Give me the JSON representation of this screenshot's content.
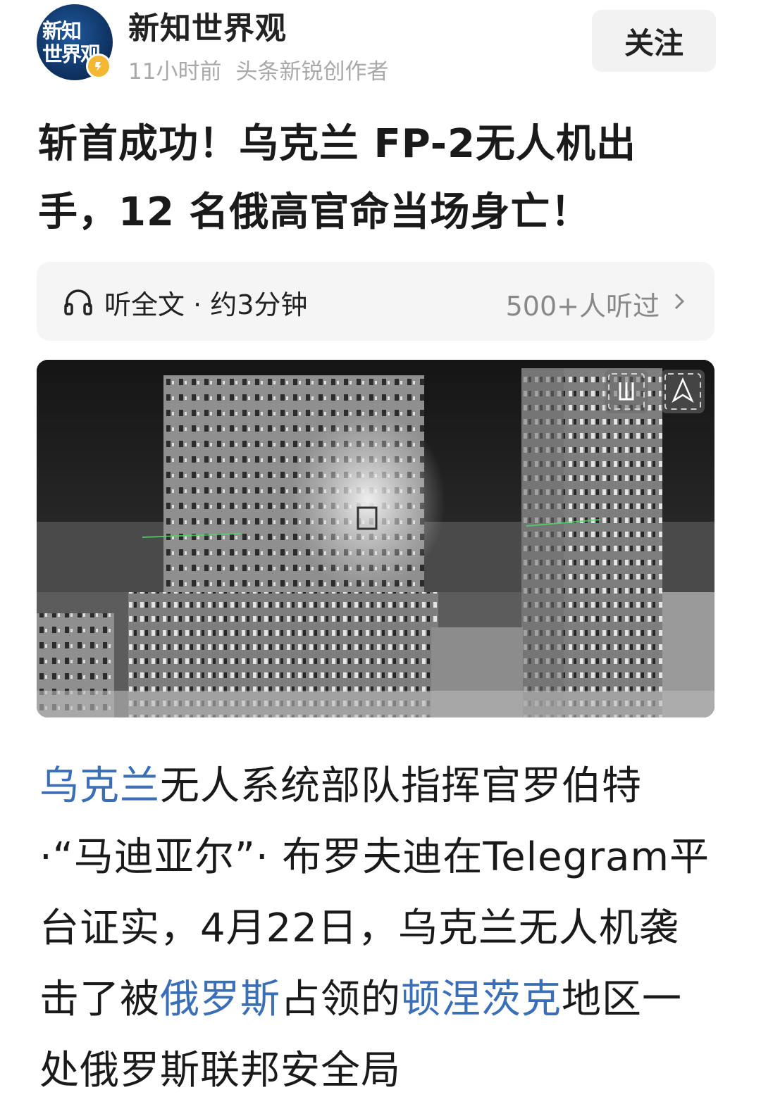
{
  "author": {
    "avatar_text": "新知\n世界观",
    "name": "新知世界观",
    "time": "11小时前",
    "badge": "头条新锐创作者",
    "follow_label": "关注"
  },
  "article": {
    "title": "斩首成功！乌克兰 FP-2无人机出手，12 名俄高官命当场身亡！",
    "listen": {
      "label": "听全文 · 约3分钟",
      "count": "500+人听过"
    },
    "image_alt": "",
    "body": {
      "t1": "乌克兰",
      "t2": "无人系统部队指挥官罗伯特·“马迪亚尔”· 布罗夫迪在Telegram平台证实，4月22日，乌克兰无人机袭击了被",
      "t3": "俄罗斯",
      "t4": "占领的",
      "t5": "顿涅茨克",
      "t6": "地区一处俄罗斯联邦安全局"
    }
  },
  "colors": {
    "link": "#3a6fb8",
    "follow_bg": "#f2f2f2",
    "badge": "#f4b731"
  },
  "icons": [
    "headphones-icon",
    "chevron-right-icon",
    "unit-emblem-icon",
    "drone-unit-icon",
    "verified-badge-icon"
  ]
}
